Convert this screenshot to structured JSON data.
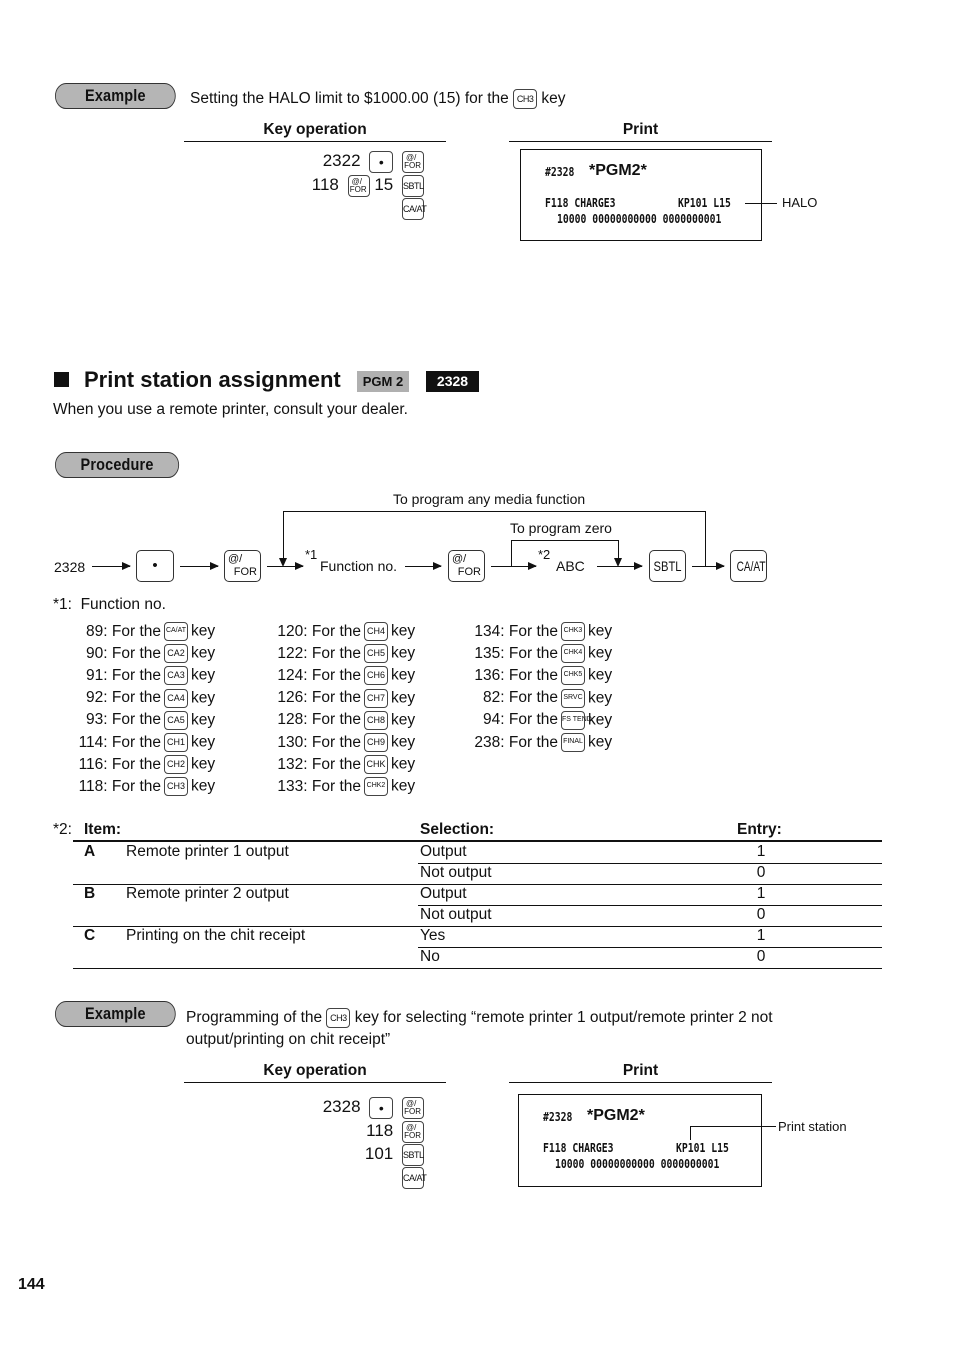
{
  "page_number": "144",
  "example1": {
    "badge": "Example",
    "description_pre": "Setting the HALO limit to $1000.00 (15) for the",
    "description_key": "CH3",
    "description_post": "key",
    "key_operation_header": "Key operation",
    "print_header": "Print",
    "key_rows": [
      {
        "prefix": "2322",
        "keys": [
          "•",
          "@/FOR"
        ]
      },
      {
        "prefix": "118",
        "keys": [
          "@/FOR"
        ],
        "middle": "15",
        "keys2": [
          "SBTL"
        ]
      },
      {
        "prefix": "",
        "keys": [
          "CA/AT"
        ]
      }
    ],
    "receipt": {
      "line1_code": "#2328",
      "line1_title": "*PGM2*",
      "line2_left": "F118 CHARGE3",
      "line2_right": "KP101 L15",
      "line3": "10000 00000000000 0000000001"
    },
    "callout": "HALO"
  },
  "section": {
    "title": "Print station assignment",
    "mode_badge": "PGM 2",
    "code_badge": "2328",
    "intro": "When you use a remote printer, consult your dealer.",
    "procedure_badge": "Procedure"
  },
  "flow": {
    "start": "2328",
    "dot_key": "•",
    "for_key_top": "@/",
    "for_key_bottom": "FOR",
    "note1_marker": "*1",
    "function_no": "Function no.",
    "note2_marker": "*2",
    "abc": "ABC",
    "sbtl_key": "SBTL",
    "caat_key": "CA/AT",
    "loop_media": "To program any media function",
    "loop_zero": "To program zero"
  },
  "note1": {
    "marker": "*1:",
    "label": "Function no.",
    "for_the": "For the",
    "key_word": "key",
    "columns": [
      [
        {
          "num": "89:",
          "key": "CA/AT"
        },
        {
          "num": "90:",
          "key": "CA2"
        },
        {
          "num": "91:",
          "key": "CA3"
        },
        {
          "num": "92:",
          "key": "CA4"
        },
        {
          "num": "93:",
          "key": "CA5"
        },
        {
          "num": "114:",
          "key": "CH1"
        },
        {
          "num": "116:",
          "key": "CH2"
        },
        {
          "num": "118:",
          "key": "CH3"
        }
      ],
      [
        {
          "num": "120:",
          "key": "CH4"
        },
        {
          "num": "122:",
          "key": "CH5"
        },
        {
          "num": "124:",
          "key": "CH6"
        },
        {
          "num": "126:",
          "key": "CH7"
        },
        {
          "num": "128:",
          "key": "CH8"
        },
        {
          "num": "130:",
          "key": "CH9"
        },
        {
          "num": "132:",
          "key": "CHK"
        },
        {
          "num": "133:",
          "key": "CHK2"
        }
      ],
      [
        {
          "num": "134:",
          "key": "CHK3"
        },
        {
          "num": "135:",
          "key": "CHK4"
        },
        {
          "num": "136:",
          "key": "CHK5"
        },
        {
          "num": "82:",
          "key": "SRVC"
        },
        {
          "num": "94:",
          "key": "FS TEND"
        },
        {
          "num": "238:",
          "key": "FINAL"
        }
      ]
    ]
  },
  "note2": {
    "marker": "*2:",
    "headers": {
      "item": "Item:",
      "selection": "Selection:",
      "entry": "Entry:"
    },
    "rows": [
      {
        "letter": "A",
        "item": "Remote printer 1 output",
        "options": [
          {
            "sel": "Output",
            "entry": "1"
          },
          {
            "sel": "Not output",
            "entry": "0"
          }
        ]
      },
      {
        "letter": "B",
        "item": "Remote printer 2 output",
        "options": [
          {
            "sel": "Output",
            "entry": "1"
          },
          {
            "sel": "Not output",
            "entry": "0"
          }
        ]
      },
      {
        "letter": "C",
        "item": "Printing on the chit receipt",
        "options": [
          {
            "sel": "Yes",
            "entry": "1"
          },
          {
            "sel": "No",
            "entry": "0"
          }
        ]
      }
    ]
  },
  "example2": {
    "badge": "Example",
    "description_pre": "Programming of the",
    "description_key": "CH3",
    "description_post": "key for selecting “remote printer 1 output/remote printer 2 not",
    "description_line2": "output/printing on chit receipt”",
    "key_operation_header": "Key operation",
    "print_header": "Print",
    "key_rows": [
      {
        "prefix": "2328",
        "keys": [
          "•",
          "@/FOR"
        ]
      },
      {
        "prefix": "118",
        "keys": [
          "@/FOR"
        ]
      },
      {
        "prefix": "101",
        "keys": [
          "SBTL"
        ]
      },
      {
        "prefix": "",
        "keys": [
          "CA/AT"
        ]
      }
    ],
    "receipt": {
      "line1_code": "#2328",
      "line1_title": "*PGM2*",
      "line2_left": "F118 CHARGE3",
      "line2_right": "KP101 L15",
      "line3": "10000 00000000000 0000000001"
    },
    "callout": "Print station"
  }
}
